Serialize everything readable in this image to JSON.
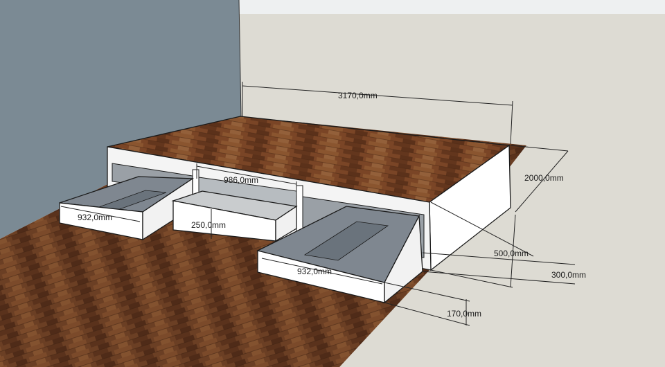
{
  "colors": {
    "wall_left": "#7b8a94",
    "wall_back": "#dddbd3",
    "sky_strip": "#eef0f1",
    "floor_wood": "#6b3f24",
    "platform_wood": "#7a4526",
    "cabinet_white": "#ffffff",
    "drawer_interior": "#7f8790",
    "dimension_line": "#222222"
  },
  "dimensions": {
    "overall_length": "3170,0mm",
    "overall_depth": "2000,0mm",
    "platform_height": "500,0mm",
    "drawer_gap": "300,0mm",
    "floor_clearance": "170,0mm",
    "middle_opening": "986,0mm",
    "left_drawer": "932,0mm",
    "middle_drawer_height": "250,0mm",
    "right_drawer": "932,0mm"
  }
}
